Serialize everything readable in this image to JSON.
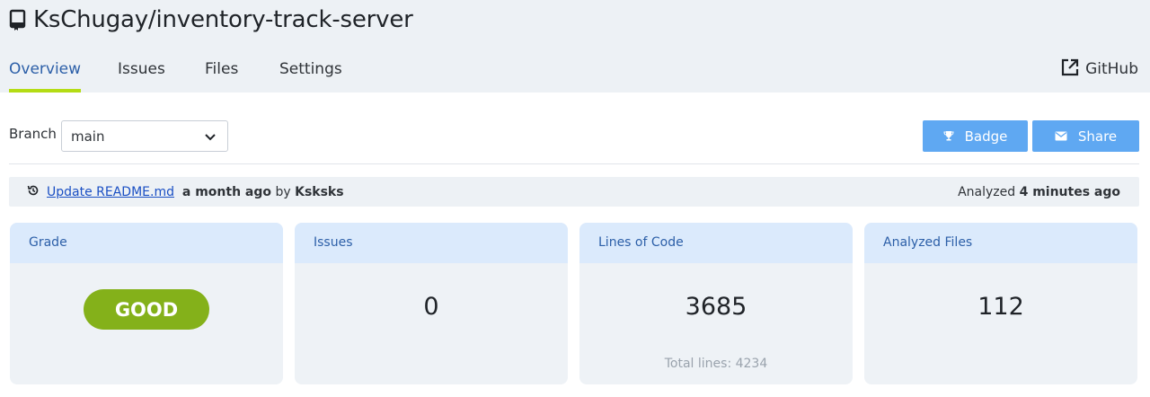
{
  "repo": {
    "title": "KsChugay/inventory-track-server"
  },
  "tabs": [
    {
      "label": "Overview",
      "active": true
    },
    {
      "label": "Issues",
      "active": false
    },
    {
      "label": "Files",
      "active": false
    },
    {
      "label": "Settings",
      "active": false
    }
  ],
  "github": {
    "label": "GitHub"
  },
  "branch": {
    "label": "Branch",
    "value": "main"
  },
  "buttons": {
    "badge": "Badge",
    "share": "Share"
  },
  "commit": {
    "message": "Update README.md",
    "time": "a month ago",
    "by": "by",
    "author": "Ksksks",
    "analyzed_label": "Analyzed",
    "analyzed_time": "4 minutes ago"
  },
  "cards": {
    "grade": {
      "title": "Grade",
      "value": "GOOD",
      "color": "#84b11a"
    },
    "issues": {
      "title": "Issues",
      "value": "0"
    },
    "loc": {
      "title": "Lines of Code",
      "value": "3685",
      "sub": "Total lines: 4234"
    },
    "files": {
      "title": "Analyzed Files",
      "value": "112"
    }
  },
  "colors": {
    "accent": "#b4dc14",
    "button": "#5fa8f2",
    "link": "#1a4fc4",
    "header_bg": "#edf1f5",
    "card_head": "#dbeafc"
  },
  "icons": {
    "repo": "book-icon",
    "github": "external-link-icon",
    "branch": "chevron-down-icon",
    "badge": "trophy-icon",
    "share": "envelope-icon",
    "commit": "history-icon"
  }
}
